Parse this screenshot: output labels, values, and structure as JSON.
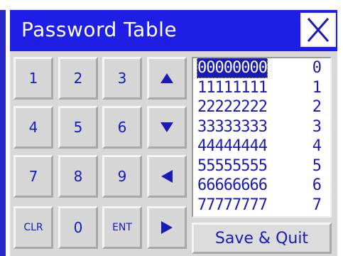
{
  "window": {
    "title": "Password Table",
    "close_icon": "close-x-icon"
  },
  "keypad": {
    "keys": [
      "1",
      "2",
      "3",
      "4",
      "5",
      "6",
      "7",
      "8",
      "9",
      "CLR",
      "0",
      "ENT"
    ],
    "arrows": [
      "arrow-up-icon",
      "arrow-down-icon",
      "arrow-left-icon",
      "arrow-right-icon"
    ]
  },
  "password_list": {
    "selected_index": 0,
    "rows": [
      {
        "password": "00000000",
        "index": "0"
      },
      {
        "password": "11111111",
        "index": "1"
      },
      {
        "password": "22222222",
        "index": "2"
      },
      {
        "password": "33333333",
        "index": "3"
      },
      {
        "password": "44444444",
        "index": "4"
      },
      {
        "password": "55555555",
        "index": "5"
      },
      {
        "password": "66666666",
        "index": "6"
      },
      {
        "password": "77777777",
        "index": "7"
      }
    ]
  },
  "actions": {
    "save_quit_label": "Save & Quit"
  },
  "colors": {
    "titlebar": "#1e1ee6",
    "text_blue": "#1a1ab4",
    "panel_gray": "#d8d8d8",
    "selection": "#1a1ab4"
  }
}
